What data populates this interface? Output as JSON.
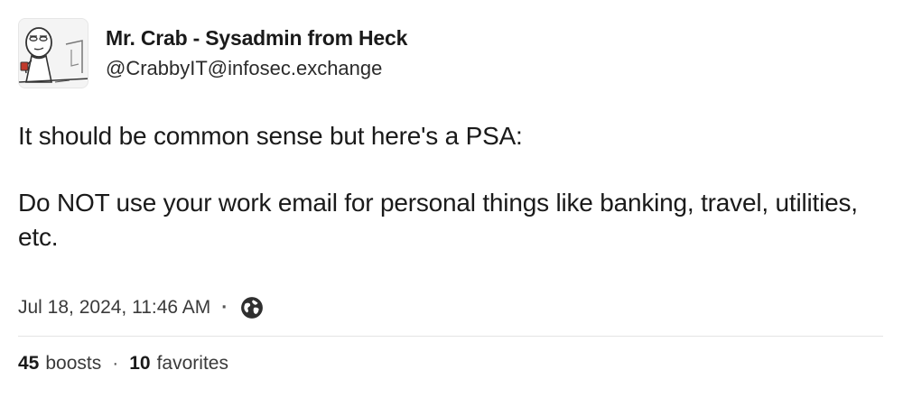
{
  "author": {
    "display_name": "Mr. Crab - Sysadmin from Heck",
    "handle": "@CrabbyIT@infosec.exchange",
    "avatar_icon": "cartoon-avatar-icon"
  },
  "post": {
    "line1": "It should be common sense but here's a PSA:",
    "line2": "Do NOT use your work email for personal things like banking, travel, utilities, etc."
  },
  "meta": {
    "timestamp": "Jul 18, 2024, 11:46 AM",
    "separator": "·",
    "visibility_icon": "globe-icon"
  },
  "stats": {
    "boosts_count": "45",
    "boosts_label": "boosts",
    "separator": "·",
    "favorites_count": "10",
    "favorites_label": "favorites"
  }
}
